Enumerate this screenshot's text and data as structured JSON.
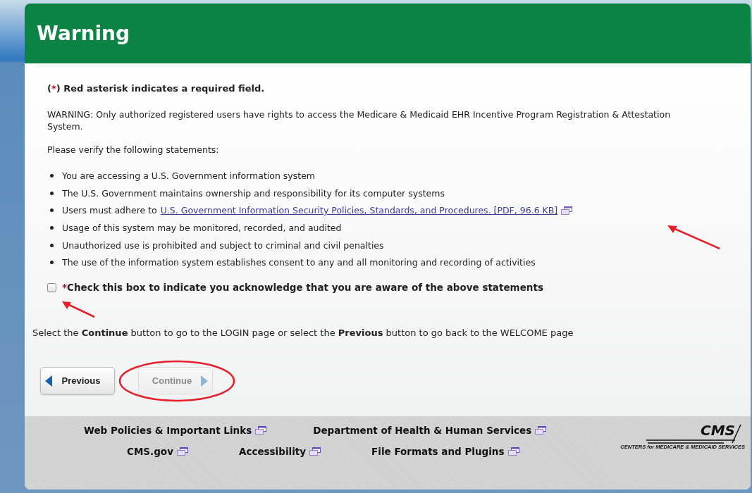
{
  "header": {
    "title": "Warning"
  },
  "required_note": {
    "open": "(",
    "mark": "*",
    "close": ")",
    "text": "Red asterisk indicates a required field."
  },
  "warning": "WARNING: Only authorized registered users have rights to access the Medicare & Medicaid EHR Incentive Program Registration & Attestation System.",
  "verify_prompt": "Please verify the following statements:",
  "statements": [
    {
      "text": "You are accessing a U.S. Government information system"
    },
    {
      "text": "The U.S. Government maintains ownership and responsibility for its computer systems"
    },
    {
      "text": "Users must adhere to",
      "link": "U.S. Government Information Security Policies, Standards, and Procedures. [PDF, 96.6 KB]"
    },
    {
      "text": "Usage of this system may be monitored, recorded, and audited"
    },
    {
      "text": "Unauthorized use is prohibited and subject to criminal and civil penalties"
    },
    {
      "text": "The use of the information system establishes consent to any and all monitoring and recording of activities"
    }
  ],
  "acknowledge": {
    "checked": false,
    "mark": "*",
    "label": "Check this box to indicate you acknowledge that you are aware of the above statements"
  },
  "instructions": "Select the **Continue** button to go to the LOGIN page or select the **Previous** button to go back to the WELCOME page",
  "buttons": [
    {
      "label": "Previous",
      "kind": "back",
      "disabled": false
    },
    {
      "label": "Continue",
      "kind": "forward",
      "disabled": true
    }
  ],
  "footer": {
    "link_rows": [
      [
        "Web Policies & Important Links",
        "Department of Health & Human Services"
      ],
      [
        "CMS.gov",
        "Accessibility",
        "File Formats and Plugins"
      ]
    ],
    "logo": {
      "name": "CMS",
      "tagline": "CENTERS for MEDICARE & MEDICAID SERVICES"
    }
  }
}
